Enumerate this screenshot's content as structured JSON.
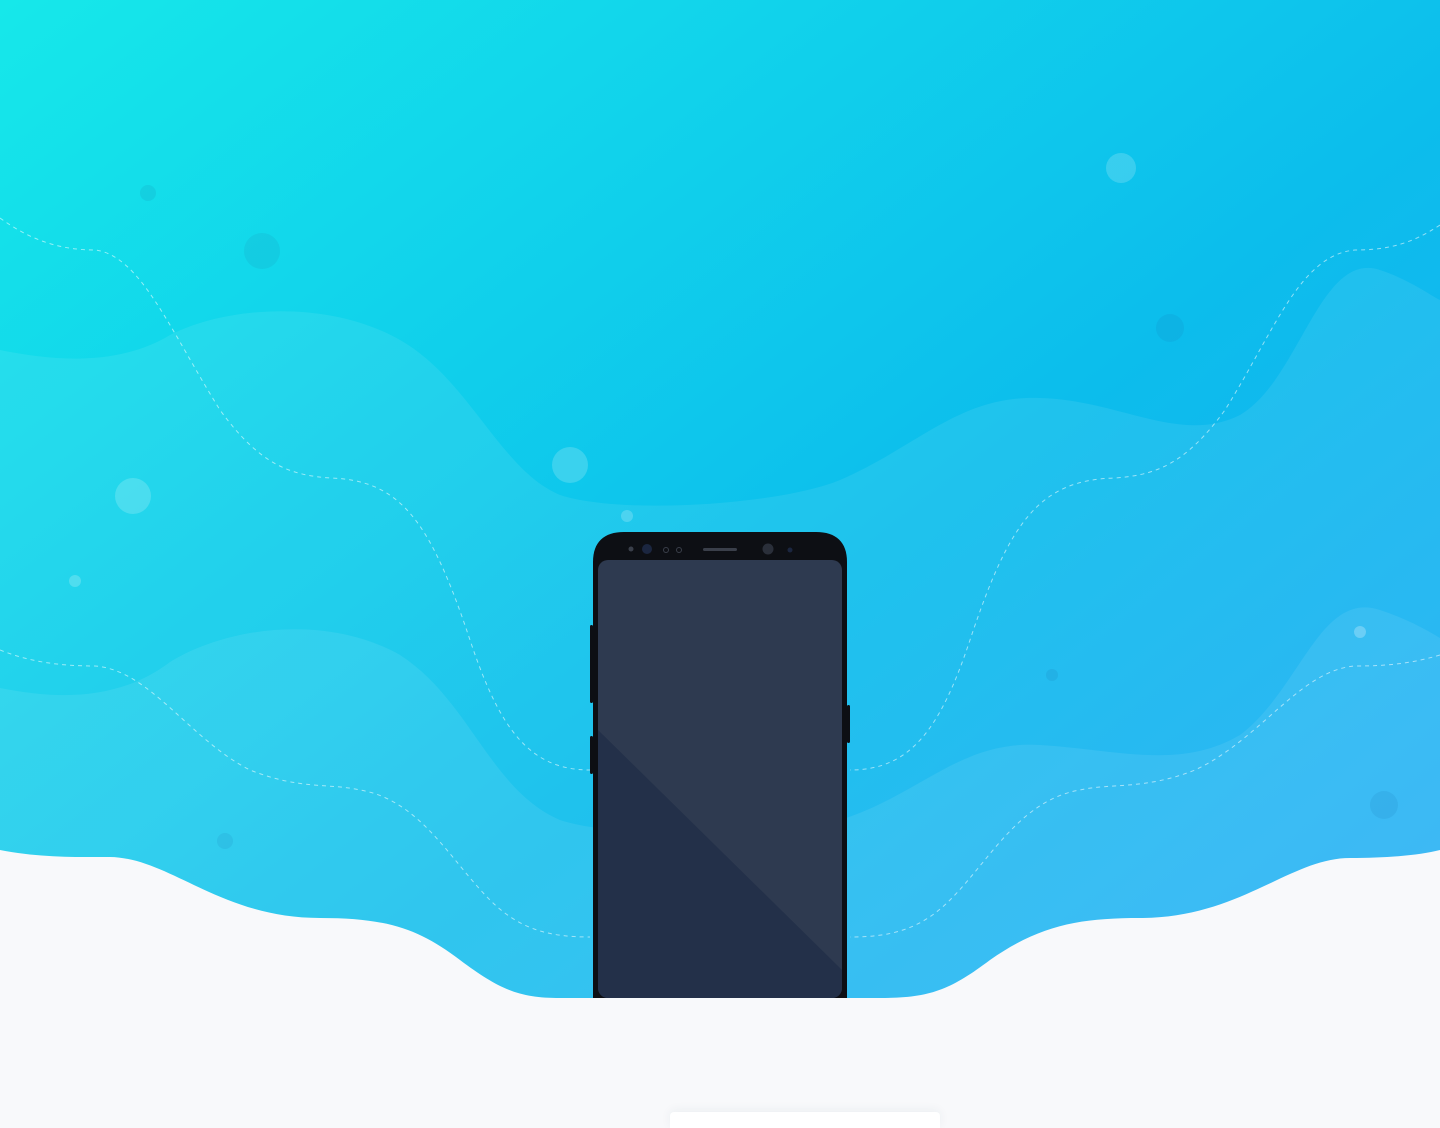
{
  "page": {
    "background_color": "#f8f9fb"
  },
  "hero": {
    "gradient_start": "#16e8ea",
    "gradient_end": "#22a8f6",
    "wave_light": "#ffffff",
    "icon": "phone-mockup"
  },
  "phone": {
    "body_color": "#0d0f14",
    "screen_color": "#2e3a50",
    "screen_shadow_color": "#233049"
  },
  "bottom_card": {
    "color": "#ffffff"
  }
}
